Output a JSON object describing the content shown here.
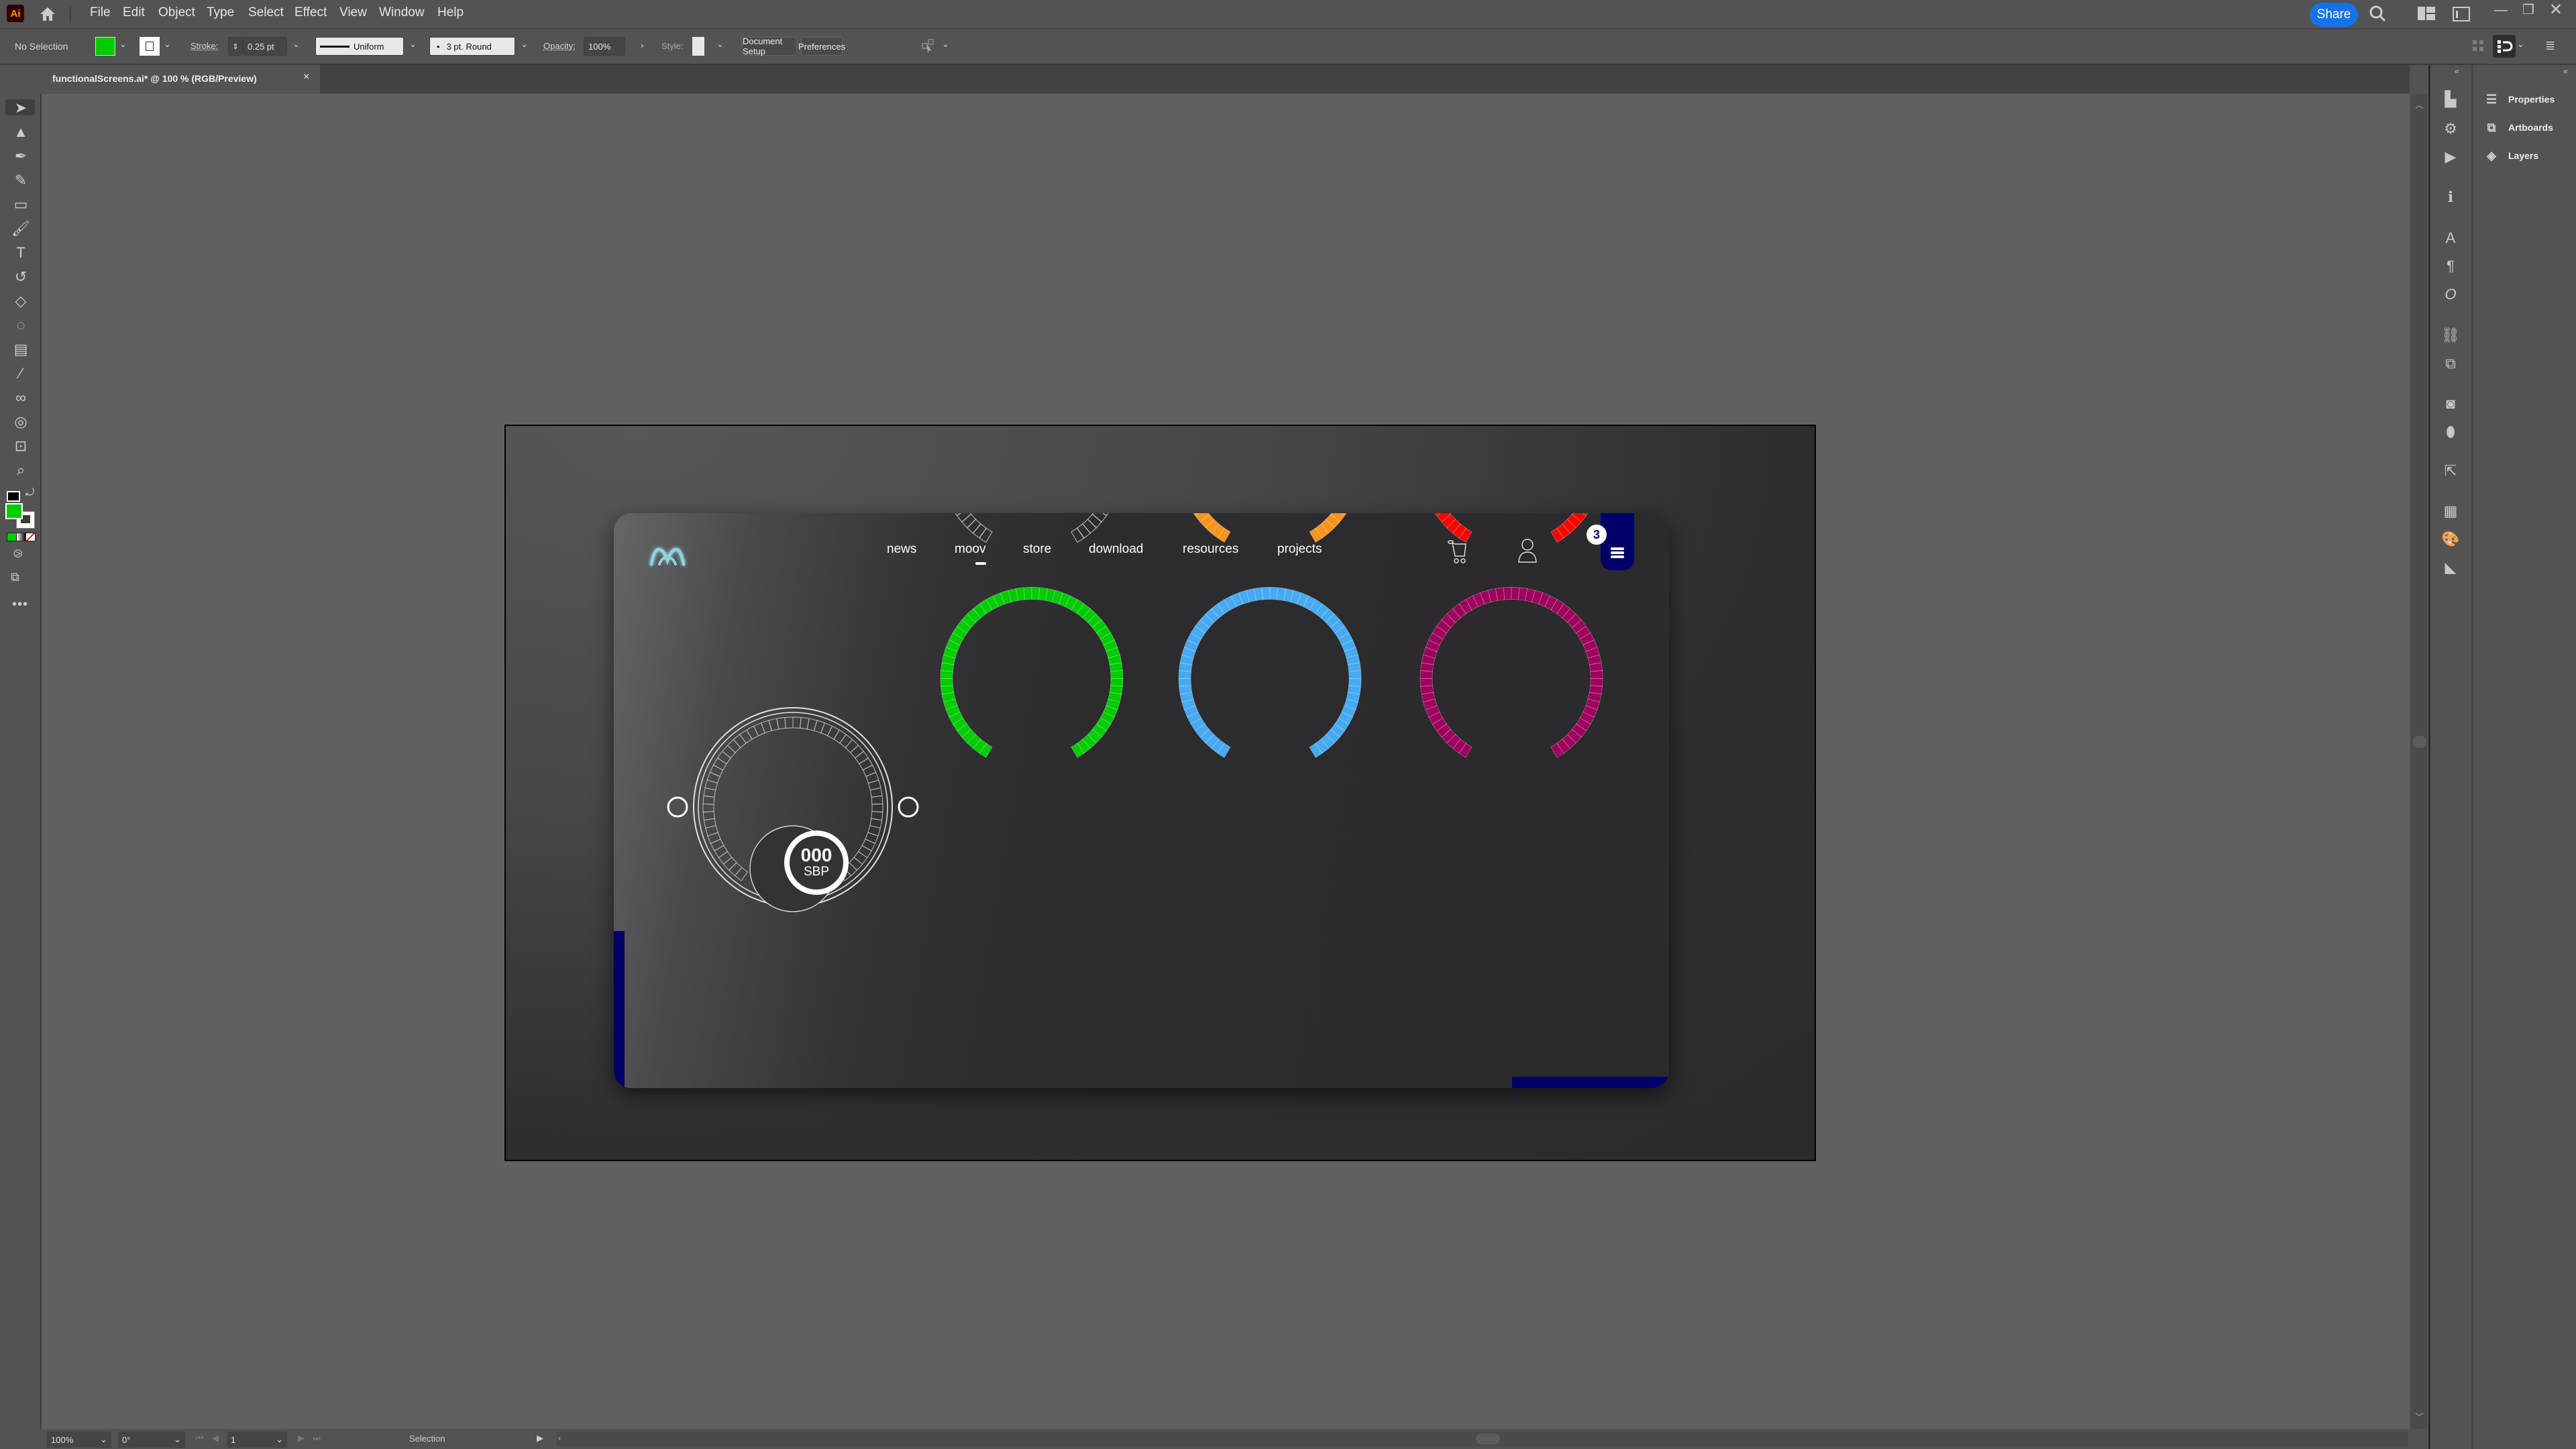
{
  "app": {
    "name": "Adobe Illustrator",
    "logo_text": "Ai",
    "menu": [
      "File",
      "Edit",
      "Object",
      "Type",
      "Select",
      "Effect",
      "View",
      "Window",
      "Help"
    ],
    "share_label": "Share"
  },
  "control_bar": {
    "selection_status": "No Selection",
    "fill_color": "#00cc00",
    "stroke_label": "Stroke:",
    "stroke_weight": "0.25 pt",
    "stroke_profile": "Uniform",
    "brush": "3 pt. Round",
    "opacity_label": "Opacity:",
    "opacity_value": "100%",
    "style_label": "Style:",
    "document_setup_label": "Document Setup",
    "preferences_label": "Preferences"
  },
  "document_tab": {
    "title": "functionalScreens.ai* @ 100 % (RGB/Preview)",
    "close_glyph": "×"
  },
  "tools": [
    {
      "name": "selection-tool",
      "glyph": "➤"
    },
    {
      "name": "direct-selection-tool",
      "glyph": "▲"
    },
    {
      "name": "pen-tool",
      "glyph": "✒"
    },
    {
      "name": "curvature-tool",
      "glyph": "✎"
    },
    {
      "name": "rectangle-tool",
      "glyph": "▭"
    },
    {
      "name": "paintbrush-tool",
      "glyph": "🖌"
    },
    {
      "name": "type-tool",
      "glyph": "T"
    },
    {
      "name": "rotate-tool",
      "glyph": "↺"
    },
    {
      "name": "eraser-tool",
      "glyph": "◇"
    },
    {
      "name": "shaper-tool",
      "glyph": "◌"
    },
    {
      "name": "gradient-tool",
      "glyph": "▤"
    },
    {
      "name": "eyedropper-tool",
      "glyph": "⁄"
    },
    {
      "name": "blend-tool",
      "glyph": "∞"
    },
    {
      "name": "shape-builder-tool",
      "glyph": "◎"
    },
    {
      "name": "artboard-tool",
      "glyph": "⊡"
    },
    {
      "name": "zoom-tool",
      "glyph": "⌕"
    }
  ],
  "fill_stroke": {
    "fill": "#00cc00",
    "stroke": "#ffffff"
  },
  "artboard_design": {
    "nav": [
      "news",
      "moov",
      "store",
      "download",
      "resources",
      "projects"
    ],
    "active_nav": "moov",
    "cart_badge_count": "3",
    "knob": {
      "value": "000",
      "unit": "SBP"
    },
    "gauges": [
      {
        "name": "gauge-outline",
        "color": "#d0d0d0",
        "style": "outline"
      },
      {
        "name": "gauge-orange",
        "color": "#f7941d",
        "style": "filled"
      },
      {
        "name": "gauge-red",
        "color": "#ff0000",
        "style": "filled"
      },
      {
        "name": "gauge-green",
        "color": "#00cc00",
        "style": "filled"
      },
      {
        "name": "gauge-blue",
        "color": "#45aaf2",
        "style": "filled"
      },
      {
        "name": "gauge-magenta",
        "color": "#9e005d",
        "style": "filled"
      }
    ],
    "accent_color": "#000066",
    "logo_color": "#8fd3de"
  },
  "right_panels": {
    "items": [
      {
        "label": "Properties",
        "icon": "sliders-icon",
        "glyph": "☰"
      },
      {
        "label": "Artboards",
        "icon": "artboards-icon",
        "glyph": "⧉"
      },
      {
        "label": "Layers",
        "icon": "layers-icon",
        "glyph": "◈"
      }
    ]
  },
  "status_bar": {
    "zoom": "100%",
    "rotation": "0°",
    "artboard_number": "1",
    "current_tool": "Selection"
  }
}
